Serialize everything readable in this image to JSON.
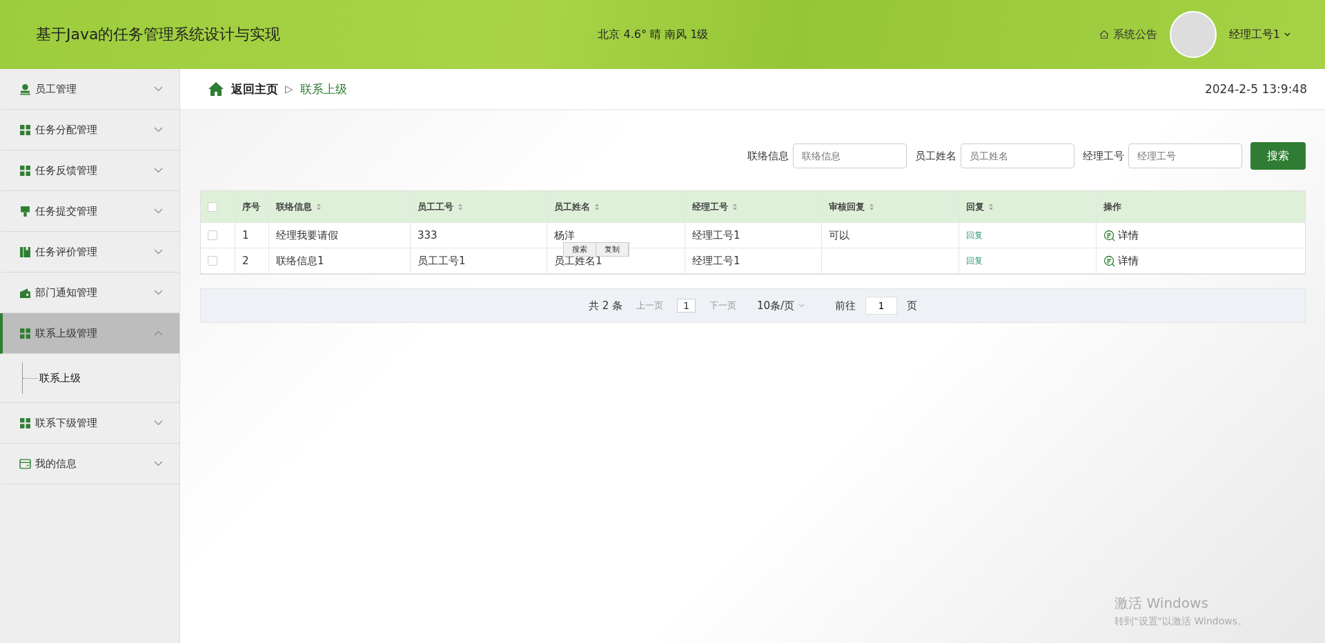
{
  "header": {
    "title": "基于Java的任务管理系统设计与实现",
    "weather": "北京  4.6°  晴  南风  1级",
    "notice": "系统公告",
    "user": "经理工号1"
  },
  "sidebar": {
    "items": [
      {
        "label": "员工管理",
        "kind": "person",
        "expanded": false,
        "selected": false
      },
      {
        "label": "任务分配管理",
        "kind": "grid",
        "expanded": false,
        "selected": false
      },
      {
        "label": "任务反馈管理",
        "kind": "grid",
        "expanded": false,
        "selected": false
      },
      {
        "label": "任务提交管理",
        "kind": "brush",
        "expanded": false,
        "selected": false
      },
      {
        "label": "任务评价管理",
        "kind": "book",
        "expanded": false,
        "selected": false
      },
      {
        "label": "部门通知管理",
        "kind": "wallet",
        "expanded": false,
        "selected": false
      },
      {
        "label": "联系上级管理",
        "kind": "grid",
        "expanded": true,
        "selected": true,
        "children": [
          {
            "label": "联系上级"
          }
        ]
      },
      {
        "label": "联系下级管理",
        "kind": "grid",
        "expanded": false,
        "selected": false
      },
      {
        "label": "我的信息",
        "kind": "card",
        "expanded": false,
        "selected": false
      }
    ]
  },
  "breadcrumb": {
    "home": "返回主页",
    "separator": "▷",
    "current": "联系上级",
    "datetime": "2024-2-5 13:9:48"
  },
  "search": {
    "fields": [
      {
        "label": "联络信息",
        "placeholder": "联络信息"
      },
      {
        "label": "员工姓名",
        "placeholder": "员工姓名"
      },
      {
        "label": "经理工号",
        "placeholder": "经理工号"
      }
    ],
    "button": "搜索"
  },
  "table": {
    "all_checked": false,
    "columns": [
      {
        "label": "序号",
        "sortable": false
      },
      {
        "label": "联络信息",
        "sortable": true
      },
      {
        "label": "员工工号",
        "sortable": true
      },
      {
        "label": "员工姓名",
        "sortable": true
      },
      {
        "label": "经理工号",
        "sortable": true
      },
      {
        "label": "审核回复",
        "sortable": true
      },
      {
        "label": "回复",
        "sortable": true
      },
      {
        "label": "操作",
        "sortable": false
      }
    ],
    "rows": [
      {
        "checked": false,
        "cells": [
          "1",
          "经理我要请假",
          "333",
          "杨洋",
          "经理工号1",
          "可以"
        ],
        "reply": "回复",
        "action": "详情"
      },
      {
        "checked": false,
        "cells": [
          "2",
          "联络信息1",
          "员工工号1",
          "员工姓名1",
          "经理工号1",
          ""
        ],
        "reply": "回复",
        "action": "详情"
      }
    ]
  },
  "context_menu": {
    "items": [
      "搜索",
      "复制"
    ]
  },
  "pagination": {
    "total": "共 2 条",
    "prev": "上一页",
    "page": "1",
    "next": "下一页",
    "page_size": "10条/页",
    "goto": "前往",
    "goto_value": "1",
    "page_unit": "页"
  },
  "os_notice": {
    "title": "激活 Windows",
    "subtitle": "转到\"设置\"以激活 Windows。"
  }
}
